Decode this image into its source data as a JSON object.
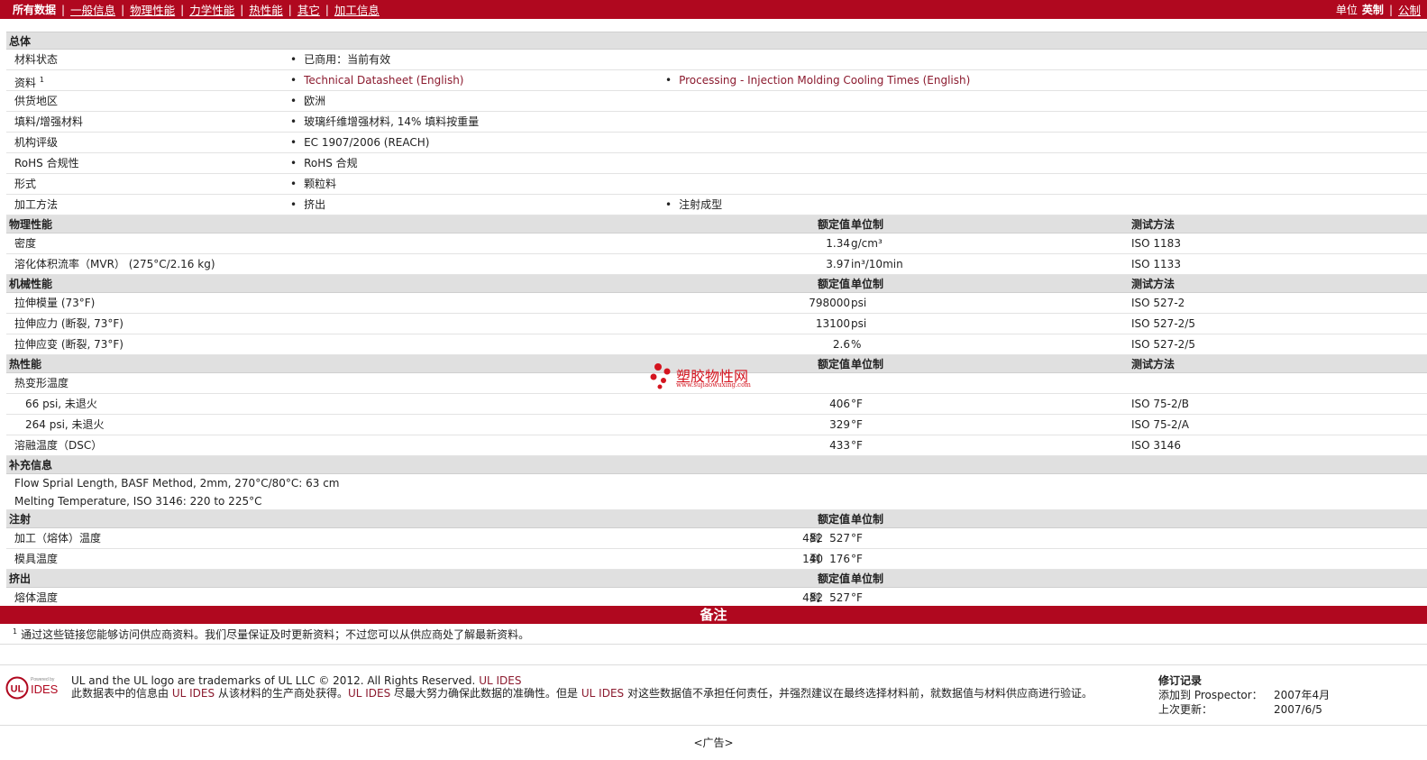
{
  "topbar": {
    "tabs": [
      "所有数据",
      "一般信息",
      "物理性能",
      "力学性能",
      "热性能",
      "其它",
      "加工信息"
    ],
    "units_label": "单位",
    "imperial": "英制",
    "metric": "公制"
  },
  "general": {
    "section": "总体",
    "material_status": {
      "label": "材料状态",
      "value": "已商用：当前有效"
    },
    "literature": {
      "label": "资料",
      "sup": "1",
      "link1": "Technical Datasheet (English)",
      "link2": "Processing - Injection Molding Cooling Times (English)"
    },
    "availability": {
      "label": "供货地区",
      "value": "欧洲"
    },
    "filler": {
      "label": "填料/增强材料",
      "value": "玻璃纤维增强材料, 14% 填料按重量"
    },
    "agency": {
      "label": "机构评级",
      "value": "EC 1907/2006 (REACH)"
    },
    "rohs": {
      "label": "RoHS 合规性",
      "value": "RoHS 合规"
    },
    "forms": {
      "label": "形式",
      "value": "颗粒料"
    },
    "processing": {
      "label": "加工方法",
      "value1": "挤出",
      "value2": "注射成型"
    }
  },
  "headers": {
    "nominal": "额定值",
    "units": "单位制",
    "test": "测试方法"
  },
  "physical": {
    "section": "物理性能",
    "rows": [
      {
        "label": "密度",
        "value": "1.34",
        "unit": "g/cm³",
        "test": "ISO 1183"
      },
      {
        "label": "溶化体积流率（MVR） (275°C/2.16 kg)",
        "value": "3.97",
        "unit": "in³/10min",
        "test": "ISO 1133"
      }
    ]
  },
  "mechanical": {
    "section": "机械性能",
    "rows": [
      {
        "label": "拉伸模量 (73°F)",
        "value": "798000",
        "unit": "psi",
        "test": "ISO 527-2"
      },
      {
        "label": "拉伸应力 (断裂, 73°F)",
        "value": "13100",
        "unit": "psi",
        "test": "ISO 527-2/5"
      },
      {
        "label": "拉伸应变 (断裂, 73°F)",
        "value": "2.6",
        "unit": "%",
        "test": "ISO 527-2/5"
      }
    ]
  },
  "thermal": {
    "section": "热性能",
    "hdt_label": "热变形温度",
    "rows": [
      {
        "label": "66 psi, 未退火",
        "value": "406",
        "unit": "°F",
        "test": "ISO 75-2/B"
      },
      {
        "label": "264 psi, 未退火",
        "value": "329",
        "unit": "°F",
        "test": "ISO 75-2/A"
      },
      {
        "label": "溶融温度（DSC）",
        "value": "433",
        "unit": "°F",
        "test": "ISO 3146"
      }
    ]
  },
  "supplemental": {
    "section": "补充信息",
    "line1": "Flow Sprial Length, BASF Method, 2mm, 270°C/80°C: 63 cm",
    "line2": "Melting Temperature, ISO 3146: 220 to 225°C"
  },
  "injection": {
    "section": "注射",
    "rows": [
      {
        "label": "加工（熔体）温度",
        "from": "482",
        "to_word": "到",
        "to": "527",
        "unit": "°F"
      },
      {
        "label": "模具温度",
        "from": "140",
        "to_word": "到",
        "to": "176",
        "unit": "°F"
      }
    ]
  },
  "extrusion": {
    "section": "挤出",
    "rows": [
      {
        "label": "熔体温度",
        "from": "482",
        "to_word": "到",
        "to": "527",
        "unit": "°F"
      }
    ]
  },
  "notes": {
    "title": "备注",
    "footnote_sup": "1",
    "footnote": "通过这些链接您能够访问供应商资料。我们尽量保证及时更新资料；不过您可以从供应商处了解最新资料。"
  },
  "footer": {
    "logo_text": {
      "powered": "Powered by",
      "brand": "IDES",
      "ul": "UL"
    },
    "line1": "UL and the UL logo are trademarks of UL LLC © 2012. All Rights Reserved.",
    "line1_link": "UL IDES",
    "line2a": "此数据表中的信息由",
    "ul_ides": "UL IDES",
    "line2b": "从该材料的生产商处获得。",
    "line2c": "尽最大努力确保此数据的准确性。但是",
    "line2d": "对这些数据值不承担任何责任，并强烈建议在最终选择材料前，就数据值与材料供应商进行验证。",
    "revision": {
      "title": "修订记录",
      "added_label": "添加到 Prospector：",
      "added_value": "2007年4月",
      "updated_label": "上次更新：",
      "updated_value": "2007/6/5"
    }
  },
  "ad": "<广告>",
  "watermark": {
    "text": "塑胶物性网",
    "url": "www.sujiaowuxing.com"
  },
  "colors": {
    "brand_red": "#b0081f",
    "link": "#8b1a2e",
    "section_bg": "#e0e0e0"
  }
}
